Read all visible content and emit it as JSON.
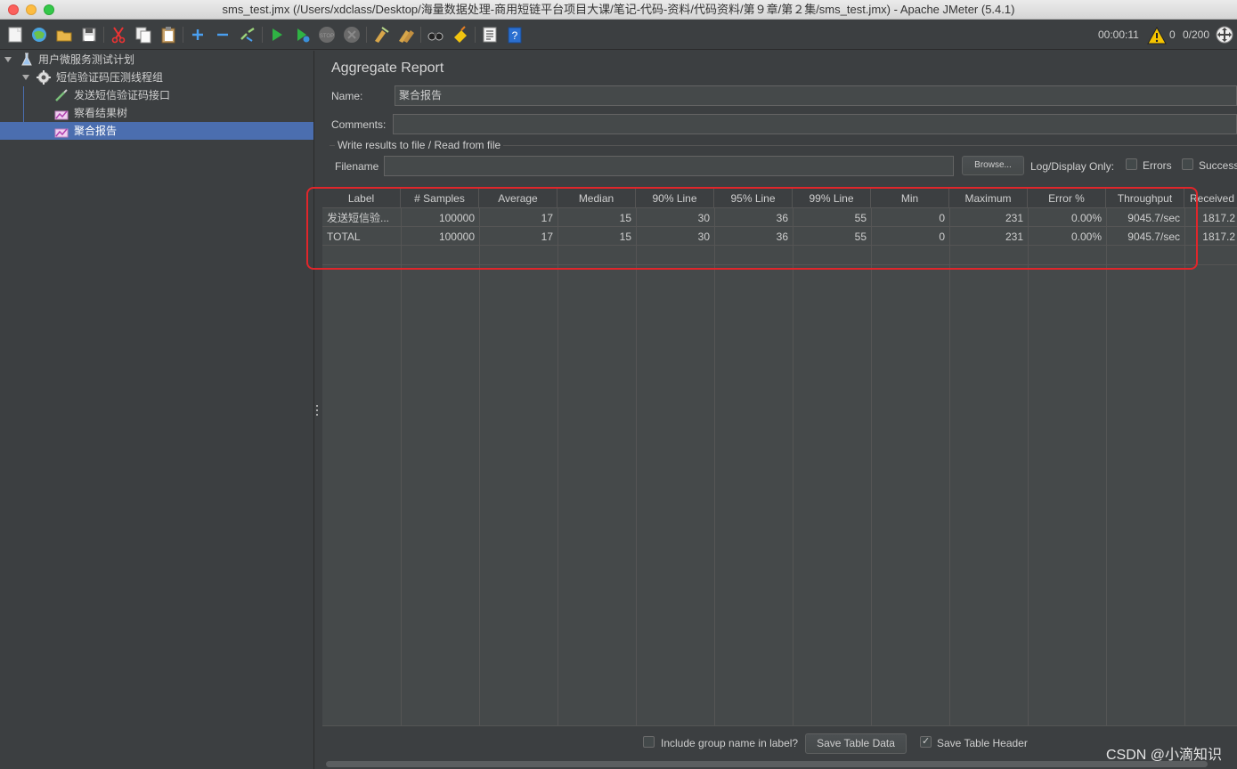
{
  "window": {
    "title": "sms_test.jmx (/Users/xdclass/Desktop/海量数据处理-商用短链平台项目大课/笔记-代码-资料/代码资料/第９章/第２集/sms_test.jmx) - Apache JMeter (5.4.1)"
  },
  "toolbar": {
    "items": [
      "new-icon",
      "templates-icon",
      "open-icon",
      "save-icon",
      "cut-icon",
      "copy-icon",
      "paste-icon",
      "expand-icon",
      "collapse-icon",
      "toggle-icon",
      "start-icon",
      "start-no-pause-icon",
      "stop-icon",
      "shutdown-icon",
      "clear-icon",
      "clear-all-icon",
      "search-icon",
      "reset-search-icon",
      "function-helper-icon",
      "help-icon"
    ],
    "elapsed": "00:00:11",
    "warnings": "0",
    "threads": "0/200"
  },
  "tree": {
    "items": [
      {
        "label": "用户微服务测试计划",
        "icon": "test-plan-icon"
      },
      {
        "label": "短信验证码压测线程组",
        "icon": "thread-group-icon"
      },
      {
        "label": "发送短信验证码接口",
        "icon": "http-sampler-icon"
      },
      {
        "label": "察看结果树",
        "icon": "listener-icon"
      },
      {
        "label": "聚合报告",
        "icon": "listener-icon"
      }
    ]
  },
  "panel": {
    "heading": "Aggregate Report",
    "name_label": "Name:",
    "name_value": "聚合报告",
    "comments_label": "Comments:",
    "comments_value": "",
    "group_title": "Write results to file / Read from file",
    "filename_label": "Filename",
    "filename_value": "",
    "browse_label": "Browse...",
    "log_display_label": "Log/Display Only:",
    "errors_label": "Errors",
    "successes_label": "Successes"
  },
  "table": {
    "headers": [
      "Label",
      "# Samples",
      "Average",
      "Median",
      "90% Line",
      "95% Line",
      "99% Line",
      "Min",
      "Maximum",
      "Error %",
      "Throughput",
      "Received KB/sec"
    ],
    "rows": [
      [
        "发送短信验...",
        "100000",
        "17",
        "15",
        "30",
        "36",
        "55",
        "0",
        "231",
        "0.00%",
        "9045.7/sec",
        "1817.2"
      ],
      [
        "TOTAL",
        "100000",
        "17",
        "15",
        "30",
        "36",
        "55",
        "0",
        "231",
        "0.00%",
        "9045.7/sec",
        "1817.2"
      ]
    ]
  },
  "bottom": {
    "include_group_label": "Include group name in label?",
    "include_group_checked": false,
    "save_table_data_label": "Save Table Data",
    "save_table_header_label": "Save Table Header",
    "save_table_header_checked": true
  },
  "watermark": "CSDN @小滴知识"
}
